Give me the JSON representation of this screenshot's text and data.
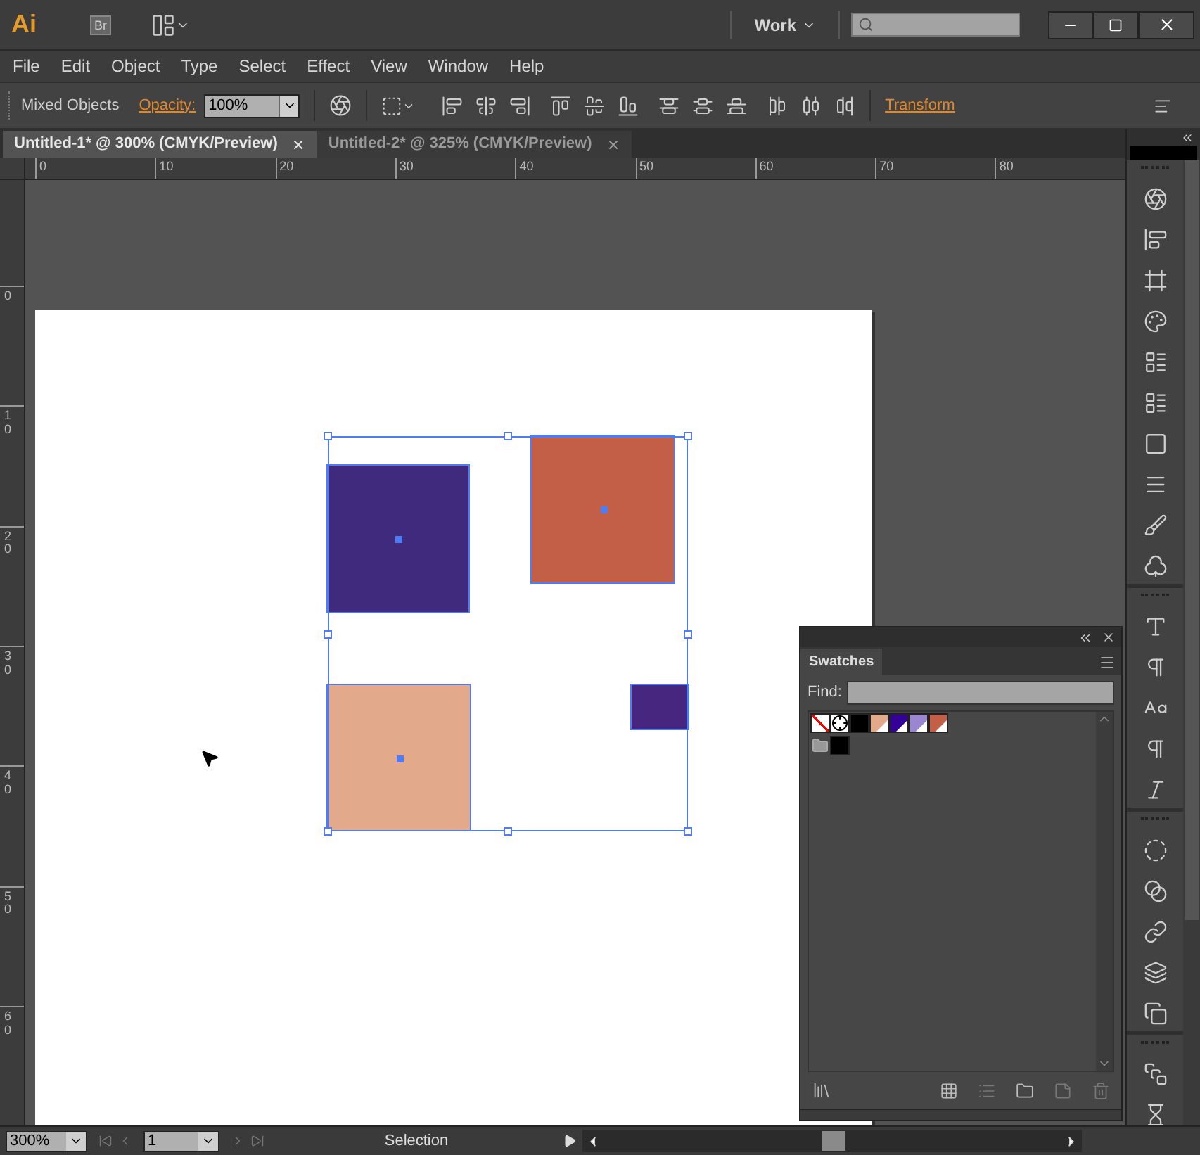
{
  "app": {
    "logo": "Ai",
    "bridge": "Br",
    "workspace": "Work"
  },
  "menu": [
    "File",
    "Edit",
    "Object",
    "Type",
    "Select",
    "Effect",
    "View",
    "Window",
    "Help"
  ],
  "control_bar": {
    "selection": "Mixed Objects",
    "opacity_label": "Opacity:",
    "opacity_value": "100%",
    "transform_link": "Transform"
  },
  "tabs": [
    {
      "label": "Untitled-1* @ 300% (CMYK/Preview)",
      "selected": true
    },
    {
      "label": "Untitled-2* @ 325% (CMYK/Preview)",
      "selected": false
    }
  ],
  "rulers": {
    "horizontal": [
      "0",
      "10",
      "20",
      "30",
      "40",
      "50",
      "60",
      "70",
      "80"
    ],
    "vertical": [
      "0",
      "10",
      "20",
      "30",
      "40",
      "50",
      "60"
    ]
  },
  "canvas_objects": [
    {
      "color": "#3f2a7e",
      "selected": true
    },
    {
      "color": "#c35e47",
      "selected": true
    },
    {
      "color": "#e2a98a",
      "selected": true
    },
    {
      "color": "#46267e",
      "selected": true
    }
  ],
  "swatches_panel": {
    "title": "Swatches",
    "find_label": "Find:",
    "swatches": [
      {
        "kind": "none"
      },
      {
        "kind": "registration"
      },
      {
        "kind": "process",
        "color": "#000000"
      },
      {
        "kind": "global",
        "color": "#e2a98a"
      },
      {
        "kind": "global",
        "color": "#330099"
      },
      {
        "kind": "global",
        "color": "#9b87d1"
      },
      {
        "kind": "global",
        "color": "#c35e47"
      },
      {
        "kind": "folder"
      },
      {
        "kind": "process",
        "color": "#000000"
      }
    ]
  },
  "status_bar": {
    "zoom": "300%",
    "page": "1",
    "tool": "Selection"
  }
}
